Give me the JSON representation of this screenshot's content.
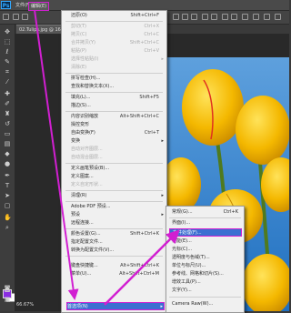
{
  "app": {
    "logo": "Ps",
    "accent": "#31a8ff",
    "highlight": "#d11fd1",
    "selection": "#3b6fd1"
  },
  "menubar": {
    "items": [
      {
        "label": "文件(F)"
      },
      {
        "label": "编辑(E)"
      }
    ]
  },
  "doc_tab": {
    "label": "02.Tulips.jpg @ 16..."
  },
  "zoom": "66.67%",
  "edit_menu": {
    "items": [
      {
        "label": "还原(O)",
        "shortcut": "Shift+Ctrl+F"
      },
      {
        "label": "剪切(T)",
        "shortcut": "Ctrl+X"
      },
      {
        "label": "拷贝(C)",
        "shortcut": "Ctrl+C"
      },
      {
        "label": "合并拷贝(Y)",
        "shortcut": "Shift+Ctrl+C"
      },
      {
        "label": "粘贴(P)",
        "shortcut": "Ctrl+V"
      },
      {
        "label": "选择性粘贴(I)",
        "shortcut": ""
      },
      {
        "label": "清除(E)",
        "shortcut": ""
      },
      {
        "label": "拼写检查(H)...",
        "shortcut": ""
      },
      {
        "label": "查找和替换文本(X)...",
        "shortcut": ""
      },
      {
        "label": "填充(L)...",
        "shortcut": "Shift+F5"
      },
      {
        "label": "描边(S)...",
        "shortcut": ""
      },
      {
        "label": "内容识别缩放",
        "shortcut": "Alt+Shift+Ctrl+C"
      },
      {
        "label": "操控变形",
        "shortcut": ""
      },
      {
        "label": "自由变换(F)",
        "shortcut": "Ctrl+T"
      },
      {
        "label": "变换",
        "shortcut": ""
      },
      {
        "label": "自动对齐图层...",
        "shortcut": ""
      },
      {
        "label": "自动混合图层...",
        "shortcut": ""
      },
      {
        "label": "定义画笔预设(B)...",
        "shortcut": ""
      },
      {
        "label": "定义图案...",
        "shortcut": ""
      },
      {
        "label": "定义自定形状...",
        "shortcut": ""
      },
      {
        "label": "清理(R)",
        "shortcut": ""
      },
      {
        "label": "Adobe PDF 预设...",
        "shortcut": ""
      },
      {
        "label": "预设",
        "shortcut": ""
      },
      {
        "label": "远程连接...",
        "shortcut": ""
      },
      {
        "label": "颜色设置(G)...",
        "shortcut": "Shift+Ctrl+K"
      },
      {
        "label": "指定配置文件...",
        "shortcut": ""
      },
      {
        "label": "转换为配置文件(V)...",
        "shortcut": ""
      },
      {
        "label": "键盘快捷键...",
        "shortcut": "Alt+Shift+Ctrl+K"
      },
      {
        "label": "菜单(U)...",
        "shortcut": "Alt+Shift+Ctrl+M"
      },
      {
        "label": "首选项(N)",
        "shortcut": ""
      }
    ]
  },
  "submenu": {
    "items": [
      {
        "label": "常规(G)...",
        "shortcut": "Ctrl+K"
      },
      {
        "label": "界面(I)...",
        "shortcut": ""
      },
      {
        "label": "文件处理(F)...",
        "shortcut": ""
      },
      {
        "label": "性能(E)...",
        "shortcut": ""
      },
      {
        "label": "光标(C)...",
        "shortcut": ""
      },
      {
        "label": "透明度与色域(T)...",
        "shortcut": ""
      },
      {
        "label": "单位与标尺(U)...",
        "shortcut": ""
      },
      {
        "label": "参考线、网格和切片(S)...",
        "shortcut": ""
      },
      {
        "label": "增效工具(P)...",
        "shortcut": ""
      },
      {
        "label": "文字(Y)...",
        "shortcut": ""
      },
      {
        "label": "Camera Raw(W)...",
        "shortcut": ""
      }
    ]
  }
}
